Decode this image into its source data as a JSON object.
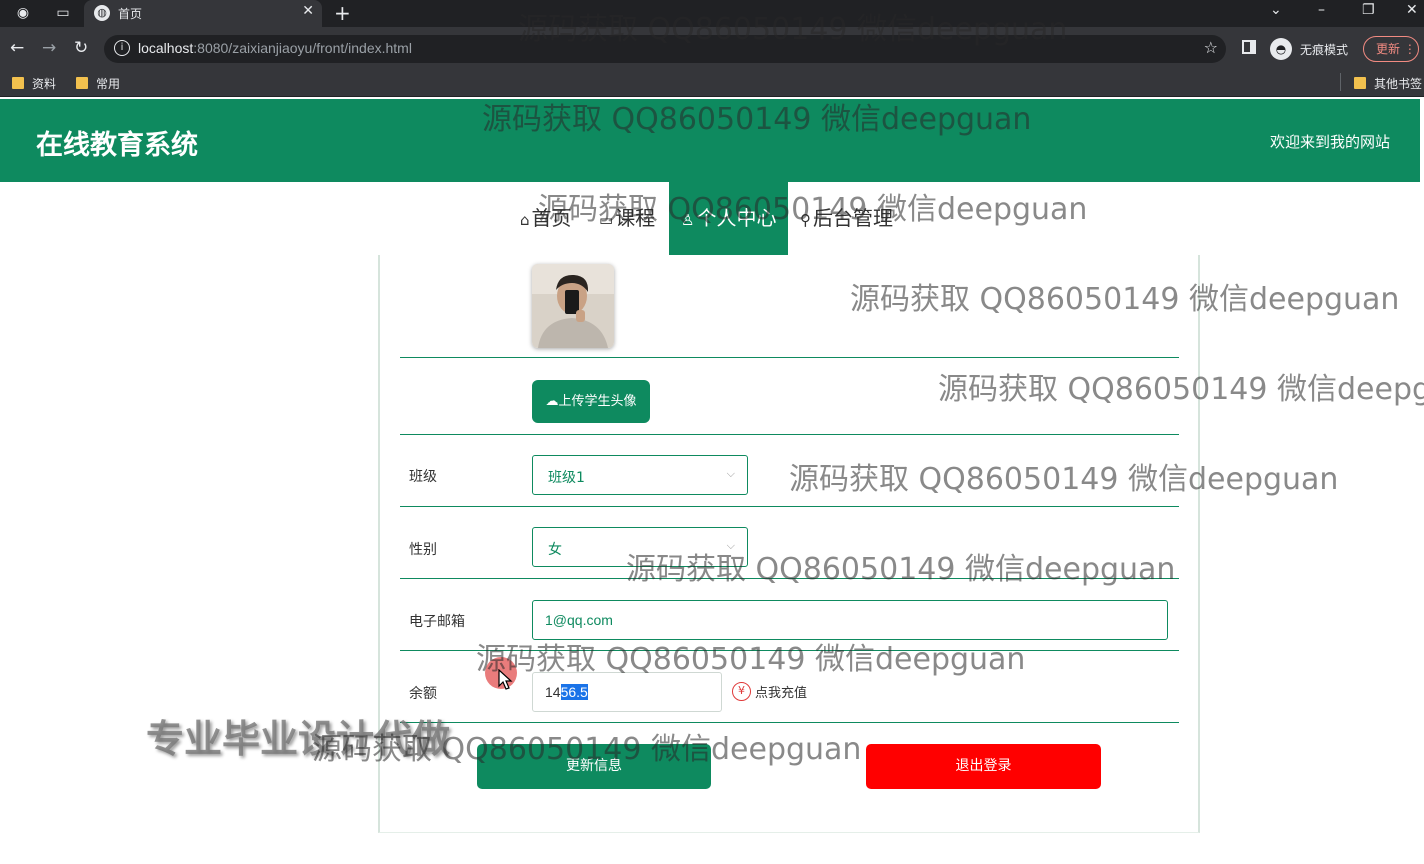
{
  "browser": {
    "tab_title": "首页",
    "url_host": "localhost",
    "url_rest": ":8080/zaixianjiaoyu/front/index.html",
    "profile_label": "无痕模式",
    "update_label": "更新",
    "bookmarks": [
      "资料",
      "常用"
    ],
    "other_bookmarks": "其他书签"
  },
  "header": {
    "title": "在线教育系统",
    "welcome": "欢迎来到我的网站"
  },
  "nav": [
    {
      "label": "首页",
      "icon": "home-icon"
    },
    {
      "label": "课程",
      "icon": "course-icon"
    },
    {
      "label": "个人中心",
      "icon": "user-icon",
      "active": true
    },
    {
      "label": "后台管理",
      "icon": "link-icon"
    }
  ],
  "profile": {
    "upload_label": "上传学生头像",
    "class_label": "班级",
    "class_value": "班级1",
    "gender_label": "性别",
    "gender_value": "女",
    "email_label": "电子邮箱",
    "email_value": "1@qq.com",
    "balance_label": "余额",
    "balance_prefix": "14",
    "balance_selected": "56.5",
    "recharge_label": "点我充值",
    "update_button": "更新信息",
    "logout_button": "退出登录"
  },
  "watermarks": {
    "text": "源码获取 QQ86050149 微信deepguan",
    "partial_text": "源码获取 QQ86050149 微信deepgu",
    "big_text": "专业毕业设计代做"
  },
  "colors": {
    "brand": "#0e8a5f",
    "danger": "#ff0000"
  }
}
